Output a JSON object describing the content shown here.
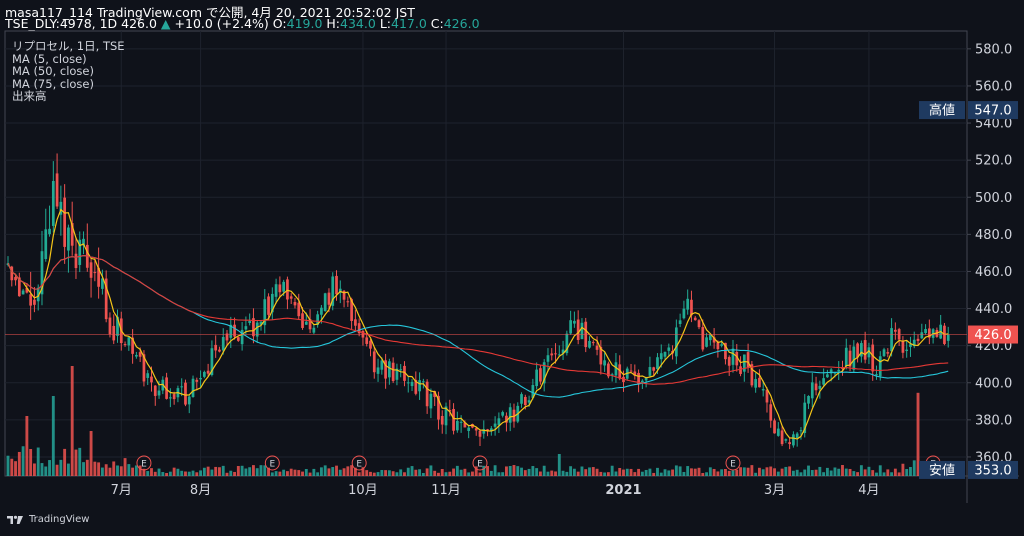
{
  "header": {
    "line1": "masa117_114 TradingView.com で公開, 4月 20, 2021 20:52:02 JST",
    "symbol": "TSE_DLY:4978, 1D 426.0",
    "change_arrow": "▲",
    "change": "+10.0 (+2.4%)",
    "o_label": "O:",
    "o_value": "419.0",
    "h_label": "H:",
    "h_value": "434.0",
    "l_label": "L:",
    "l_value": "417.0",
    "c_label": "C:",
    "c_value": "426.0"
  },
  "legend": {
    "title": "リプロセル, 1日, TSE",
    "ma5": "MA (5, close)",
    "ma50": "MA (50, close)",
    "ma75": "MA (75, close)",
    "volume": "出来高"
  },
  "badges": {
    "high_label": "高値",
    "high_value": "547.0",
    "low_label": "安値",
    "low_value": "353.0",
    "last_value": "426.0"
  },
  "earnings_marker": "E",
  "footer": {
    "brand": "TradingView",
    "logo_icon": "tradingview-logo-icon"
  },
  "colors": {
    "background": "#0f121a",
    "up": "#26a69a",
    "up_candle": "#22ab94",
    "down": "#ef5350",
    "ma5": "#f5c518",
    "ma50": "#26c6da",
    "ma75": "#e53935",
    "badge": "#1f3a60"
  },
  "chart_data": {
    "type": "candlestick",
    "symbol": "TSE_DLY:4978",
    "interval": "1D",
    "y_ticks": [
      "580.0",
      "560.0",
      "540.0",
      "520.0",
      "500.0",
      "480.0",
      "460.0",
      "440.0",
      "420.0",
      "400.0",
      "380.0",
      "360.0"
    ],
    "ylim": [
      350,
      585
    ],
    "x_ticks": [
      {
        "label": "7月",
        "index": 30
      },
      {
        "label": "8月",
        "index": 51
      },
      {
        "label": "10月",
        "index": 94
      },
      {
        "label": "11月",
        "index": 116
      },
      {
        "label": "2021",
        "index": 163
      },
      {
        "label": "3月",
        "index": 203
      },
      {
        "label": "4月",
        "index": 228
      }
    ],
    "earnings_indices": [
      36,
      70,
      93,
      125,
      192,
      245
    ],
    "close_profile": [
      [
        0,
        462
      ],
      [
        6,
        441
      ],
      [
        12,
        498
      ],
      [
        16,
        478
      ],
      [
        22,
        466
      ],
      [
        28,
        426
      ],
      [
        32,
        420
      ],
      [
        38,
        398
      ],
      [
        44,
        396
      ],
      [
        48,
        392
      ],
      [
        52,
        408
      ],
      [
        58,
        426
      ],
      [
        64,
        428
      ],
      [
        72,
        452
      ],
      [
        76,
        438
      ],
      [
        80,
        426
      ],
      [
        86,
        452
      ],
      [
        90,
        446
      ],
      [
        94,
        418
      ],
      [
        98,
        408
      ],
      [
        104,
        406
      ],
      [
        108,
        400
      ],
      [
        114,
        384
      ],
      [
        118,
        378
      ],
      [
        122,
        370
      ],
      [
        126,
        376
      ],
      [
        130,
        382
      ],
      [
        134,
        384
      ],
      [
        138,
        392
      ],
      [
        142,
        410
      ],
      [
        146,
        420
      ],
      [
        150,
        430
      ],
      [
        154,
        424
      ],
      [
        158,
        410
      ],
      [
        162,
        406
      ],
      [
        166,
        404
      ],
      [
        170,
        410
      ],
      [
        176,
        422
      ],
      [
        180,
        444
      ],
      [
        182,
        428
      ],
      [
        186,
        420
      ],
      [
        190,
        416
      ],
      [
        196,
        408
      ],
      [
        200,
        392
      ],
      [
        204,
        374
      ],
      [
        208,
        370
      ],
      [
        214,
        400
      ],
      [
        220,
        412
      ],
      [
        226,
        418
      ],
      [
        230,
        410
      ],
      [
        234,
        426
      ],
      [
        238,
        416
      ],
      [
        242,
        422
      ],
      [
        246,
        426
      ]
    ],
    "ma_lines": [
      {
        "name": "MA (5, close)",
        "color": "#f5c518"
      },
      {
        "name": "MA (50, close)",
        "color": "#26c6da"
      },
      {
        "name": "MA (75, close)",
        "color": "#e53935"
      }
    ],
    "last_price": 426.0,
    "high_marker": 547.0,
    "low_marker": 353.0
  }
}
